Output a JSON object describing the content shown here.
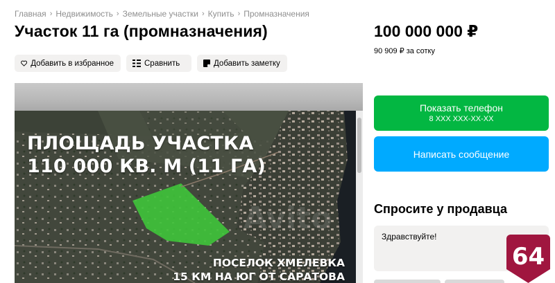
{
  "breadcrumb": [
    "Главная",
    "Недвижимость",
    "Земельные участки",
    "Купить",
    "Промназначения"
  ],
  "listing": {
    "title": "Участок 11 га (промназначения)",
    "price": "100 000 000 ₽",
    "price_per_unit": "90 909 ₽ за сотку"
  },
  "actions": {
    "favorite": "Добавить в избранное",
    "compare": "Сравнить",
    "note": "Добавить заметку"
  },
  "photo": {
    "caption_area_line1": "ПЛОЩАДЬ УЧАСТКА",
    "caption_area_line2": "110 000 КВ. М (11 ГА)",
    "caption_place_line1": "ПОСЕЛОК ХМЕЛЕВКА",
    "caption_place_line2": "15 КМ НА ЮГ ОТ САРАТОВА",
    "watermark": "Avito"
  },
  "contact": {
    "show_phone": "Показать телефон",
    "phone_mask": "8 XXX XXX-XX-XX",
    "write_message": "Написать сообщение"
  },
  "ask_seller": {
    "title": "Спросите у продавца",
    "message_value": "Здравствуйте!"
  },
  "badge": {
    "text": "64"
  },
  "colors": {
    "phone_button": "#03b742",
    "message_button": "#00aaff",
    "badge": "#a0163f",
    "chip_bg": "#f2f1f0"
  }
}
